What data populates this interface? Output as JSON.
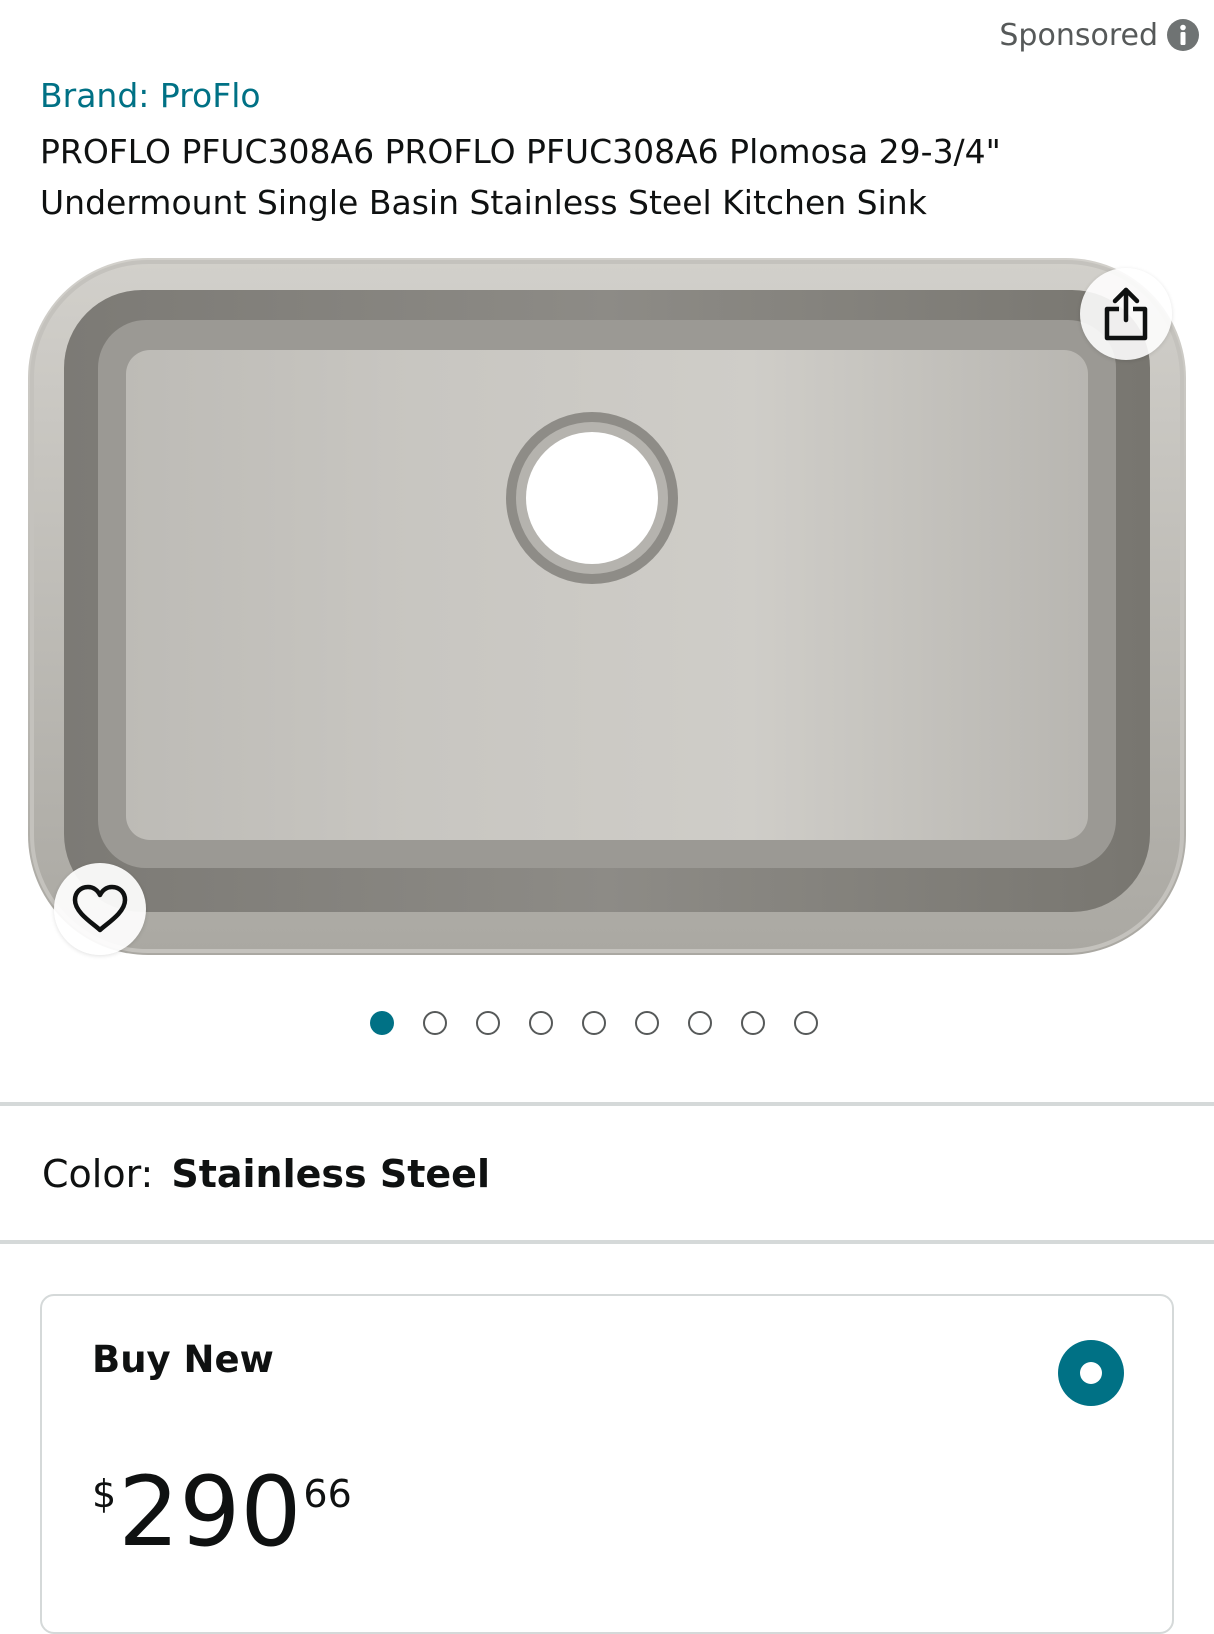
{
  "header": {
    "sponsored_label": "Sponsored",
    "brand_label": "Brand: ProFlo",
    "product_title": "PROFLO PFUC308A6 PROFLO PFUC308A6 Plomosa 29-3/4\" Undermount Single Basin Stainless Steel Kitchen Sink"
  },
  "gallery": {
    "image_subject": "stainless steel undermount single basin kitchen sink",
    "image_count": 9,
    "active_index": 0,
    "icons": {
      "share": "share-icon",
      "wishlist": "heart-icon",
      "info": "info-icon"
    }
  },
  "variation": {
    "label": "Color:",
    "value": "Stainless Steel"
  },
  "buy_box": {
    "option_label": "Buy New",
    "selected": true,
    "price": {
      "symbol": "$",
      "whole": "290",
      "fraction": "66"
    }
  },
  "colors": {
    "link": "#007185",
    "text": "#0f1111",
    "muted": "#565959",
    "divider": "#d5d9d9"
  }
}
